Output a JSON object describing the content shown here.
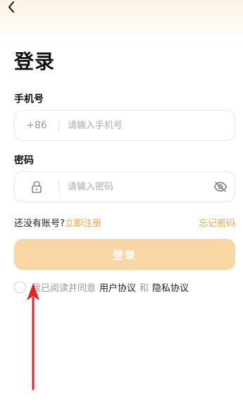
{
  "header": {
    "back_icon": "chevron-left-icon"
  },
  "page": {
    "title": "登录"
  },
  "phone": {
    "label": "手机号",
    "prefix": "+86",
    "placeholder": "请输入手机号"
  },
  "password": {
    "label": "密码",
    "placeholder": "请输入密码",
    "lock_icon": "lock-icon",
    "eye_icon": "eye-off-icon"
  },
  "links": {
    "no_account": "还没有账号?",
    "register": "立即注册",
    "forgot": "忘记密码"
  },
  "login_button": {
    "label": "登录"
  },
  "agreement": {
    "prefix": "我已阅读并同意",
    "user_agreement": "用户协议",
    "and": "和",
    "privacy_agreement": "隐私协议",
    "checked": false
  },
  "colors": {
    "accent": "#f2a43a",
    "button_disabled": "#f9d7a4",
    "annotation_arrow": "#e8202a"
  }
}
